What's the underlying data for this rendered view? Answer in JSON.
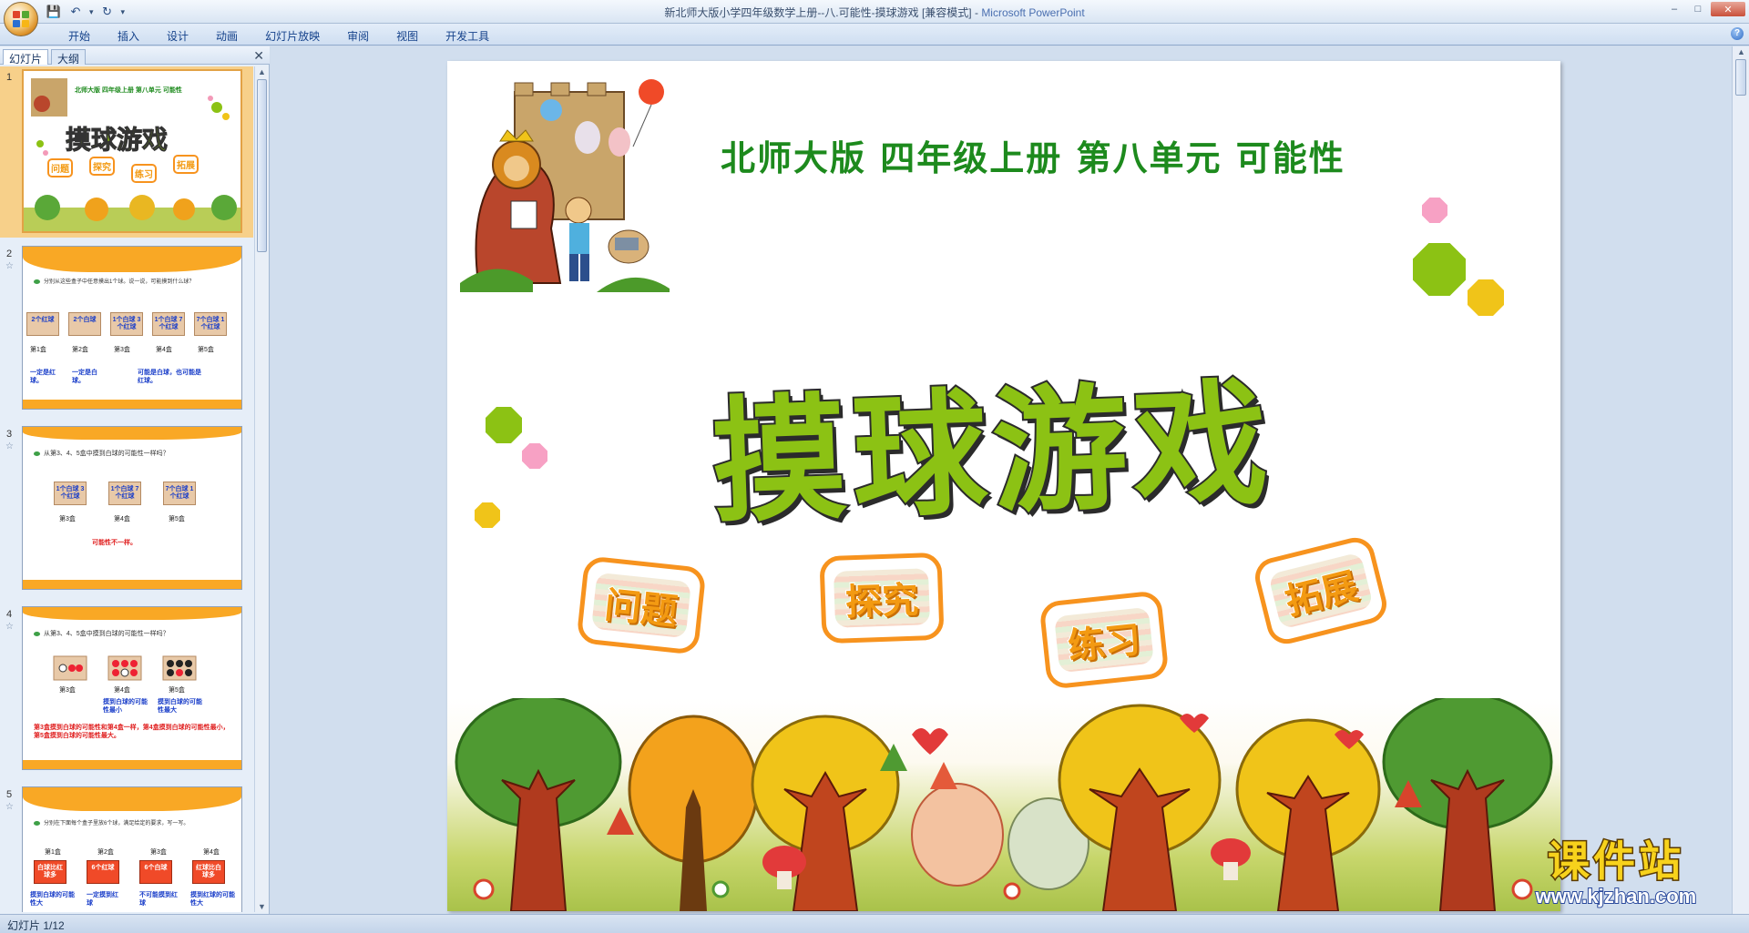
{
  "window": {
    "title": "新北师大版小学四年级数学上册--八.可能性-摸球游戏 [兼容模式] - ",
    "app_name": "Microsoft PowerPoint",
    "minimize": "–",
    "maximize": "□",
    "close": "✕"
  },
  "qat": {
    "save": "💾",
    "undo": "↶",
    "redo": "↻",
    "dropdown": "▾"
  },
  "ribbon": {
    "tabs": [
      "开始",
      "插入",
      "设计",
      "动画",
      "幻灯片放映",
      "审阅",
      "视图",
      "开发工具"
    ],
    "help": "?"
  },
  "left_pane": {
    "tabs": [
      "幻灯片",
      "大纲"
    ],
    "close": "✕",
    "thumbnails": [
      {
        "number": "1",
        "subtitle": "北师大版 四年级上册 第八单元 可能性",
        "title": "摸球游戏",
        "badges": [
          "问题",
          "探究",
          "练习",
          "拓展"
        ]
      },
      {
        "number": "2",
        "question": "分别从这些盒子中任意摸出1个球。说一说，可能摸到什么球？",
        "boxes": [
          "2个红球",
          "2个白球",
          "1个白球 3个红球",
          "1个白球 7个红球",
          "7个白球 1个红球"
        ],
        "labels": [
          "第1盒",
          "第2盒",
          "第3盒",
          "第4盒",
          "第5盒"
        ],
        "answers": [
          "一定是红球。",
          "一定是白球。",
          "可能是白球，也可能是红球。"
        ]
      },
      {
        "number": "3",
        "question": "从第3、4、5盒中摸到白球的可能性一样吗？",
        "boxes": [
          "1个白球 3个红球",
          "1个白球 7个红球",
          "7个白球 1个红球"
        ],
        "labels": [
          "第3盒",
          "第4盒",
          "第5盒"
        ],
        "answer": "可能性不一样。"
      },
      {
        "number": "4",
        "question": "从第3、4、5盒中摸到白球的可能性一样吗？",
        "labels": [
          "第3盒",
          "第4盒",
          "第5盒"
        ],
        "notes": [
          "摸到白球的可能性最小",
          "摸到白球的可能性最大"
        ],
        "conclusion": "第3盒摸到白球的可能性和第4盒一样，第4盒摸到白球的可能性最小，第5盒摸到白球的可能性最大。"
      },
      {
        "number": "5",
        "question": "分别在下面每个盒子里放6个球，满足给定的要求，写一写。",
        "labels": [
          "第1盒",
          "第2盒",
          "第3盒",
          "第4盒"
        ],
        "boxes": [
          "白球比红球多",
          "6个红球",
          "6个白球",
          "红球比白球多"
        ],
        "notes": [
          "摸到白球的可能性大",
          "一定摸到红球",
          "不可能摸到红球",
          "摸到红球的可能性大"
        ]
      }
    ]
  },
  "slide": {
    "subtitle": "北师大版  四年级上册  第八单元  可能性",
    "title": "摸球游戏",
    "badges": [
      "问题",
      "探究",
      "练习",
      "拓展"
    ]
  },
  "status": {
    "slide_indicator": "幻灯片 1/12"
  },
  "watermark": {
    "top": "课件站",
    "bottom": "www.kjzhan.com"
  },
  "colors": {
    "title_green": "#8cc214",
    "subtitle_green": "#1d8a1d",
    "badge_orange": "#f7931e",
    "ribbon_blue": "#15428b"
  }
}
